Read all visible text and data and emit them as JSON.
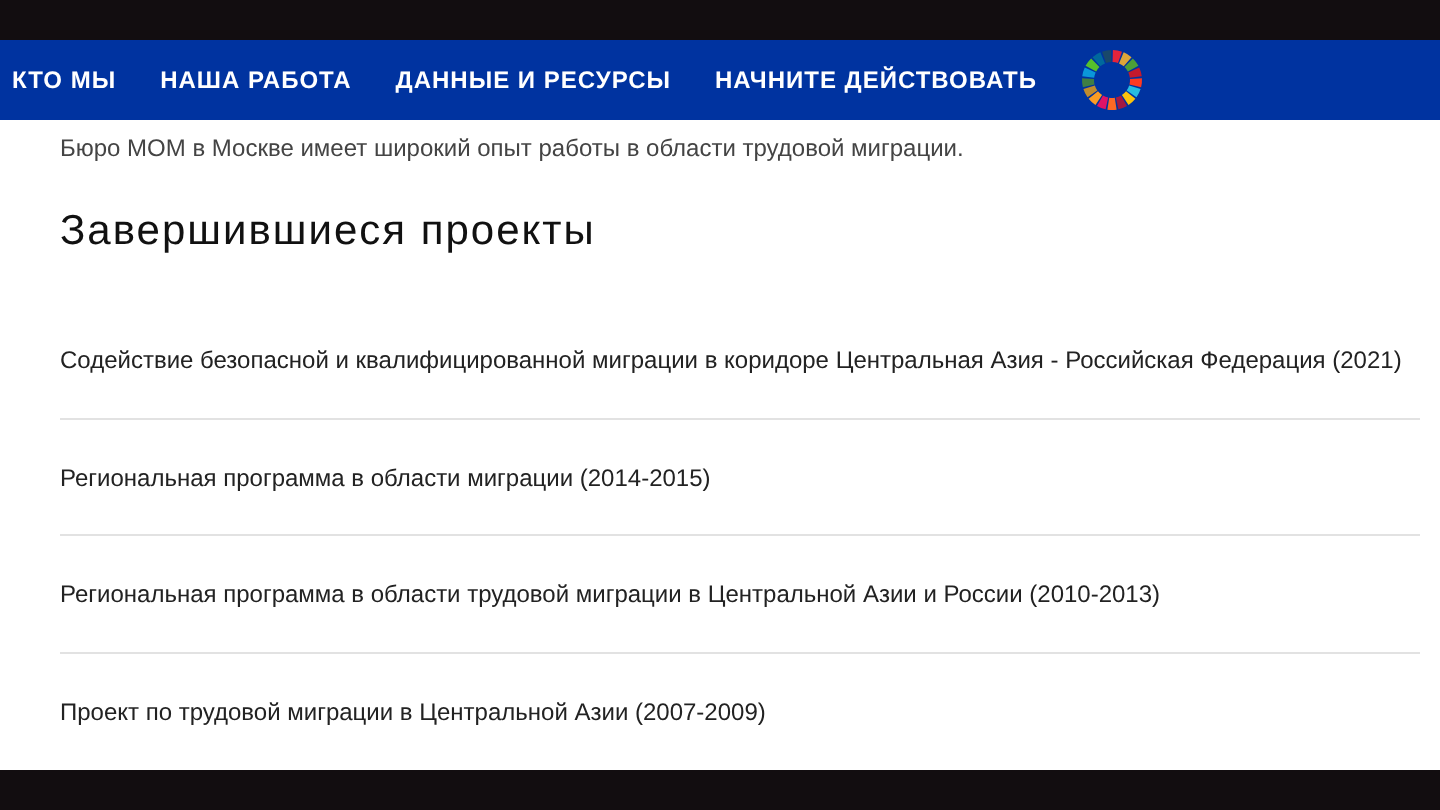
{
  "nav": {
    "items": [
      "КТО МЫ",
      "НАША РАБОТА",
      "ДАННЫЕ И РЕСУРСЫ",
      "НАЧНИТЕ ДЕЙСТВОВАТЬ"
    ]
  },
  "intro": "Бюро МОМ в Москве имеет широкий опыт работы в области трудовой миграции.",
  "section_title": "Завершившиеся проекты",
  "projects": [
    "Содействие безопасной и квалифицированной миграции в коридоре Центральная Азия - Российская Федерация (2021)",
    "Региональная программа в области миграции (2014-2015)",
    "Региональная программа в области трудовой миграции в Центральной Азии и России (2010-2013)",
    "Проект по трудовой миграции в Центральной Азии (2007-2009)"
  ]
}
